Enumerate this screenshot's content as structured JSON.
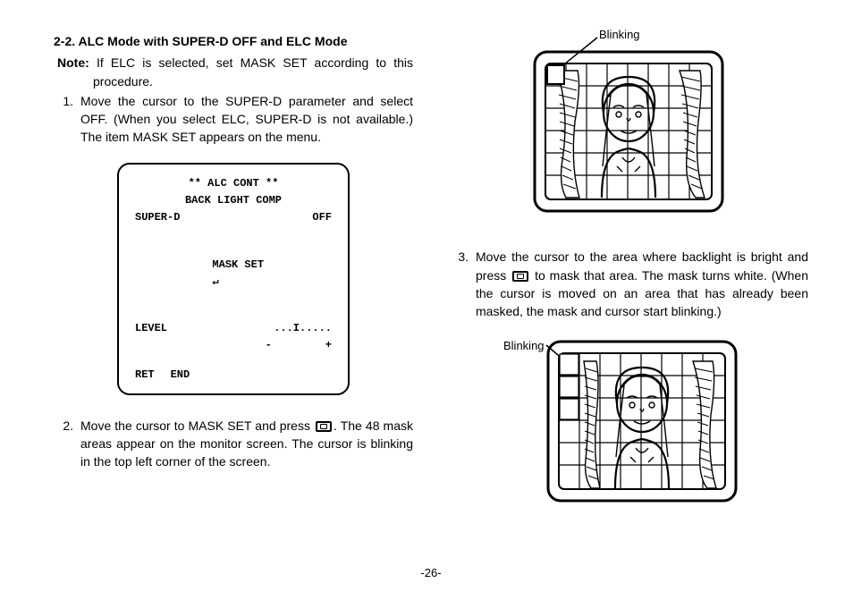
{
  "left": {
    "section_title": "2-2. ALC Mode with SUPER-D OFF and ELC Mode",
    "note_label": "Note:",
    "note_body": "If ELC is selected, set MASK SET  according to this procedure.",
    "step1_num": "1.",
    "step1_body": "Move the cursor to the SUPER-D parameter and select OFF. (When you select ELC, SUPER-D is not available.) The item MASK SET appears on the menu.",
    "menu": {
      "title": "**  ALC  CONT  **",
      "subtitle": "BACK  LIGHT  COMP",
      "row_superd_label": "SUPER-D",
      "row_superd_value": "OFF",
      "row_maskset_label": "MASK SET",
      "row_maskset_arrow": "↵",
      "row_level_label": "LEVEL",
      "row_level_value": "...I.....",
      "row_level_minus": "-",
      "row_level_plus": "+",
      "row_ret": "RET",
      "row_end": "END"
    },
    "step2_num": "2.",
    "step2_body_a": "Move the cursor to MASK SET and press ",
    "step2_body_b": ". The 48 mask areas appear on the monitor screen. The cursor is blinking in the top left corner of the screen."
  },
  "right": {
    "fig1_label": "Blinking",
    "step3_num": "3.",
    "step3_body_a": "Move the cursor to the area where backlight is bright and press ",
    "step3_body_b": " to mask that area. The mask turns white. (When the cursor is moved on an area that has already been masked, the mask and cursor start blinking.)",
    "fig2_label": "Blinking"
  },
  "page_number": "-26-"
}
